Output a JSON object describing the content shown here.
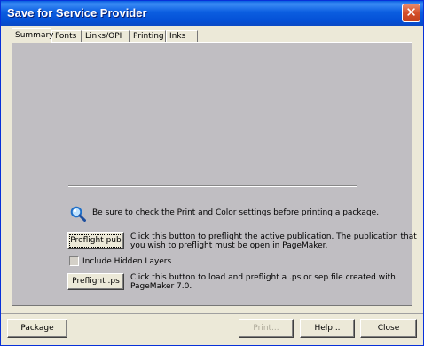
{
  "window": {
    "title": "Save for Service Provider",
    "close_glyph": "✕"
  },
  "tabs": [
    {
      "label": "Summary",
      "active": true
    },
    {
      "label": "Fonts"
    },
    {
      "label": "Links/OPI"
    },
    {
      "label": "Printing"
    },
    {
      "label": "Inks"
    }
  ],
  "summary": {
    "reminder_icon": "magnifier-icon",
    "reminder_text": "Be sure to check the Print and Color settings before printing a package.",
    "preflight_pub_button": "Preflight pub",
    "preflight_pub_desc_line1": "Click this button to preflight the active publication. The publication that",
    "preflight_pub_desc_line2": "you wish to preflight must be open in PageMaker.",
    "include_hidden_layers_label": "Include Hidden Layers",
    "include_hidden_layers_checked": false,
    "preflight_ps_button": "Preflight .ps",
    "preflight_ps_desc_line1": "Click this button to load and preflight a .ps or sep file created with",
    "preflight_ps_desc_line2": "PageMaker 7.0."
  },
  "footer": {
    "package_button": "Package",
    "print_button": "Print...",
    "help_button": "Help...",
    "close_button": "Close"
  },
  "colors": {
    "titlebar": "#0b5ee0",
    "panel": "#c0bec2",
    "dialog": "#ece9d8"
  }
}
